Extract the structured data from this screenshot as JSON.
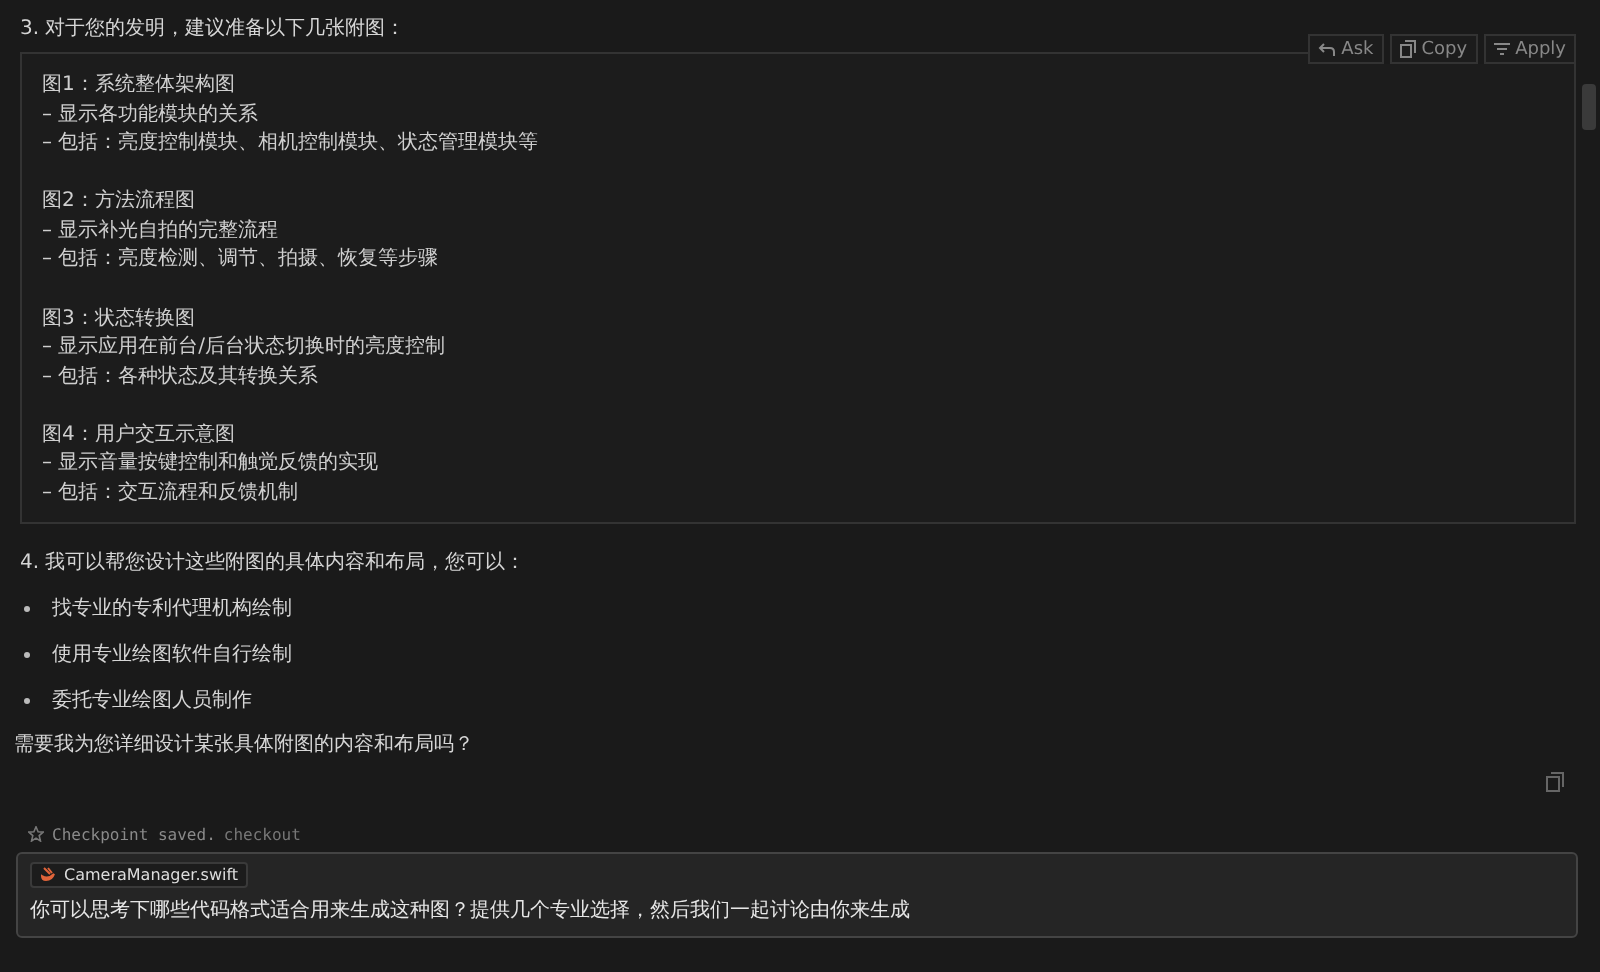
{
  "section_3": {
    "heading": "3. 对于您的发明，建议准备以下几张附图：",
    "code_block": {
      "actions": [
        {
          "kind": "ask",
          "label": "Ask"
        },
        {
          "kind": "copy",
          "label": "Copy"
        },
        {
          "kind": "apply",
          "label": "Apply"
        }
      ],
      "groups": [
        {
          "lines": [
            "图1：系统整体架构图",
            "– 显示各功能模块的关系",
            "– 包括：亮度控制模块、相机控制模块、状态管理模块等"
          ]
        },
        {
          "lines": [
            "图2：方法流程图",
            "– 显示补光自拍的完整流程",
            "– 包括：亮度检测、调节、拍摄、恢复等步骤"
          ]
        },
        {
          "lines": [
            "图3：状态转换图",
            "– 显示应用在前台/后台状态切换时的亮度控制",
            "– 包括：各种状态及其转换关系"
          ]
        },
        {
          "lines": [
            "图4：用户交互示意图",
            "– 显示音量按键控制和触觉反馈的实现",
            "– 包括：交互流程和反馈机制"
          ]
        }
      ]
    }
  },
  "section_4": {
    "heading": "4. 我可以帮您设计这些附图的具体内容和布局，您可以：",
    "bullets": [
      "找专业的专利代理机构绘制",
      "使用专业绘图软件自行绘制",
      "委托专业绘图人员制作"
    ],
    "question": "需要我为您详细设计某张具体附图的内容和布局吗？"
  },
  "checkpoint": {
    "text": "Checkpoint saved.",
    "link": "checkout"
  },
  "input": {
    "file_chip": "CameraManager.swift",
    "value": "你可以思考下哪些代码格式适合用来生成这种图？提供几个专业选择，然后我们一起讨论由你来生成"
  }
}
